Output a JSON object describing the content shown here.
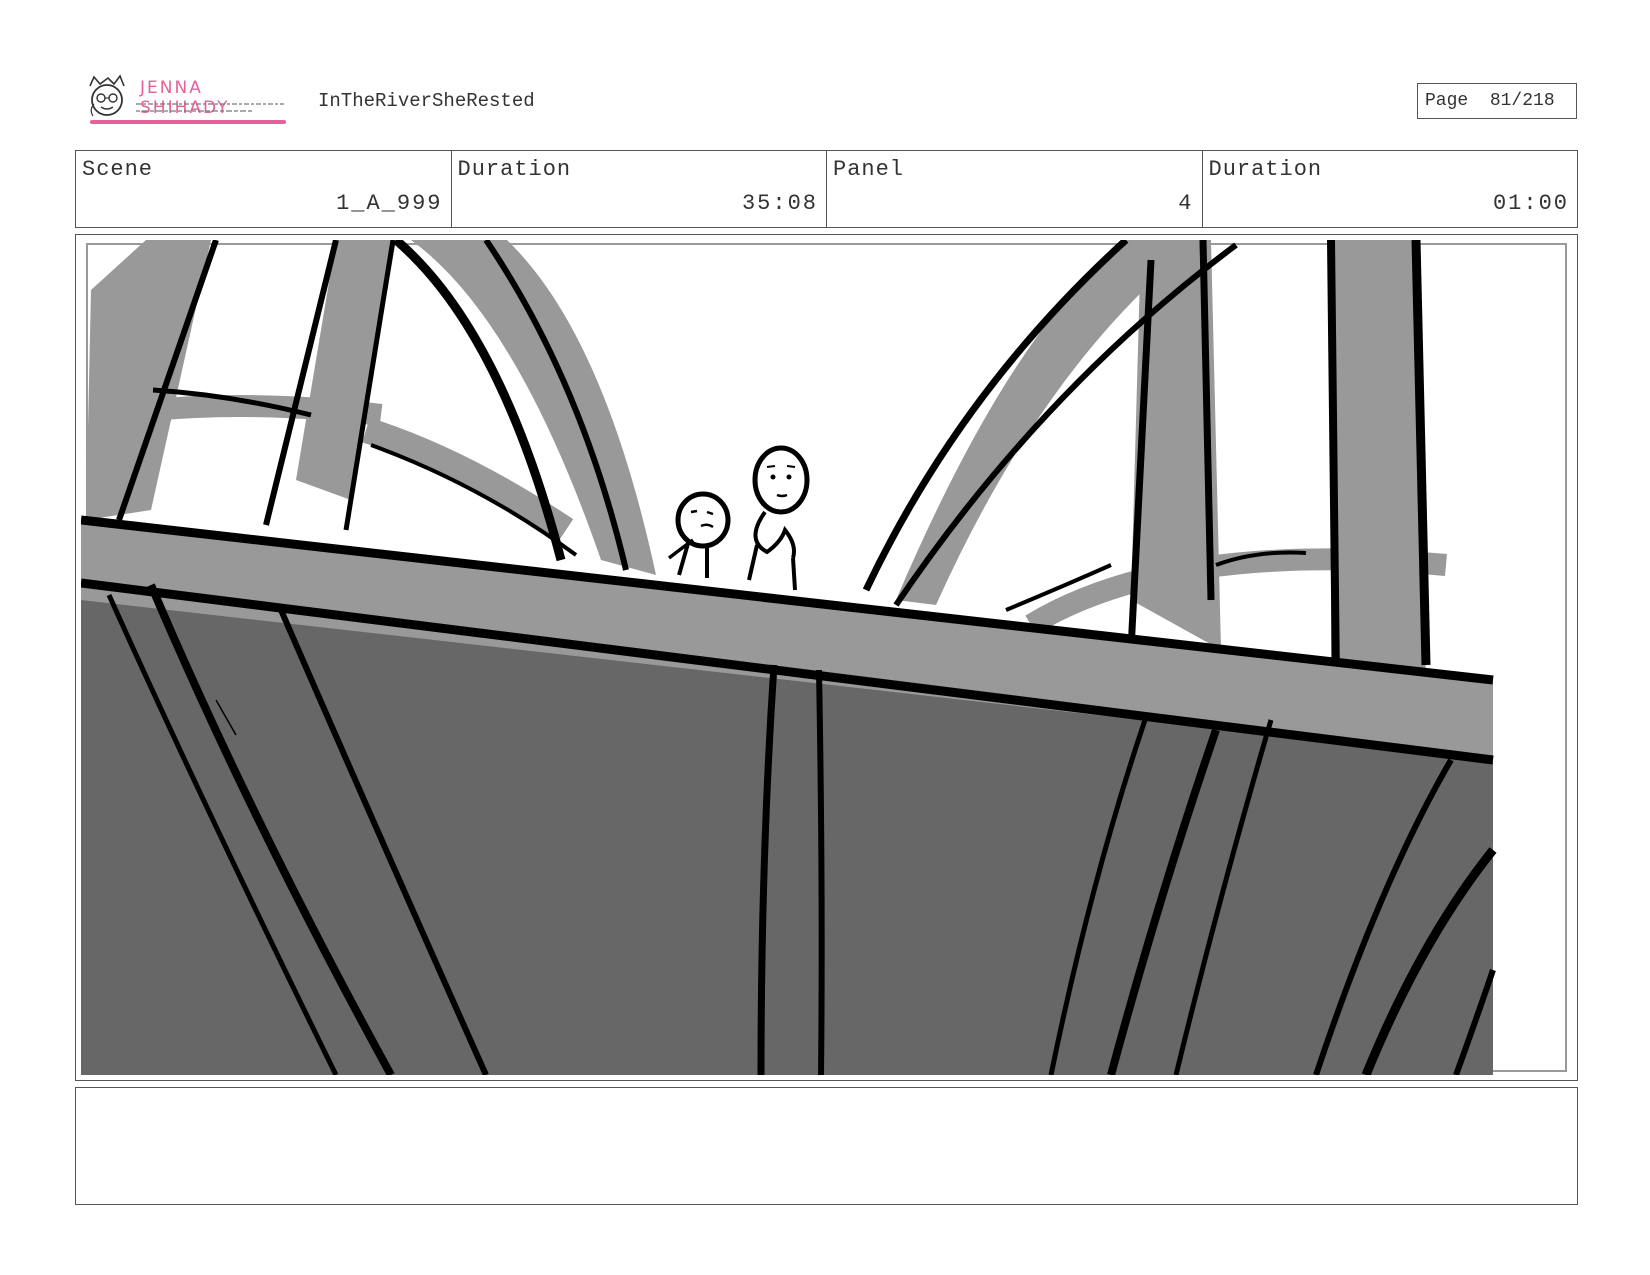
{
  "header": {
    "logo_name": "JENNA SHIHADY",
    "project_title": "InTheRiverSheRested",
    "page_label": "Page",
    "page_number": "81/218"
  },
  "info": {
    "scene_label": "Scene",
    "scene_value": "1_A_999",
    "duration_label": "Duration",
    "duration_value": "35:08",
    "panel_label": "Panel",
    "panel_value": "4",
    "panel_duration_label": "Duration",
    "panel_duration_value": "01:00"
  },
  "colors": {
    "sky": "#ffffff",
    "beam_gray": "#999999",
    "shadow_gray": "#676767",
    "ink": "#000000",
    "accent_pink": "#e8609a"
  }
}
